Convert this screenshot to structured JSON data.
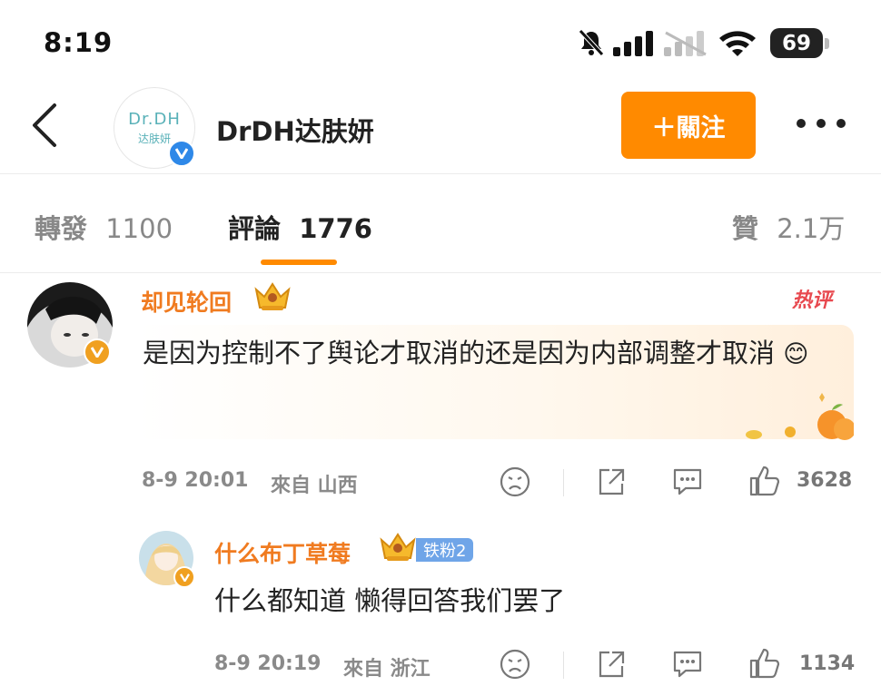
{
  "status_bar": {
    "time": "8:19",
    "battery": "69"
  },
  "header": {
    "logo_main": "Dr.DH",
    "logo_sub": "达肤妍",
    "account_name": "DrDH达肤妍",
    "follow_label": "＋關注"
  },
  "tabs": [
    {
      "label": "轉發",
      "count": "1100"
    },
    {
      "label": "評論",
      "count": "1776"
    },
    {
      "label": "贊",
      "count": "2.1万"
    }
  ],
  "comments": [
    {
      "username": "却见轮回",
      "hot_label": "热评",
      "text": "是因为控制不了舆论才取消的还是因为内部调整才取消",
      "emoji": "😊",
      "date": "8-9 20:01",
      "source": "來自 山西",
      "likes": "3628"
    },
    {
      "username": "什么布丁草莓",
      "badge": "铁粉2",
      "text": "什么都知道 懒得回答我们罢了",
      "date": "8-9 20:19",
      "source": "來自 浙江",
      "likes": "1134"
    }
  ],
  "colors": {
    "accent": "#ff8a00",
    "username": "#f07b20",
    "verified_blue": "#2e88e8",
    "verified_orange": "#f0a020",
    "hot": "#e8494f"
  },
  "icons": [
    "back-chevron-icon",
    "mute-bell-icon",
    "signal-icon",
    "wifi-icon",
    "more-icon",
    "verified-icon",
    "crown-icon",
    "dislike-face-icon",
    "share-icon",
    "comment-icon",
    "thumb-up-icon"
  ]
}
